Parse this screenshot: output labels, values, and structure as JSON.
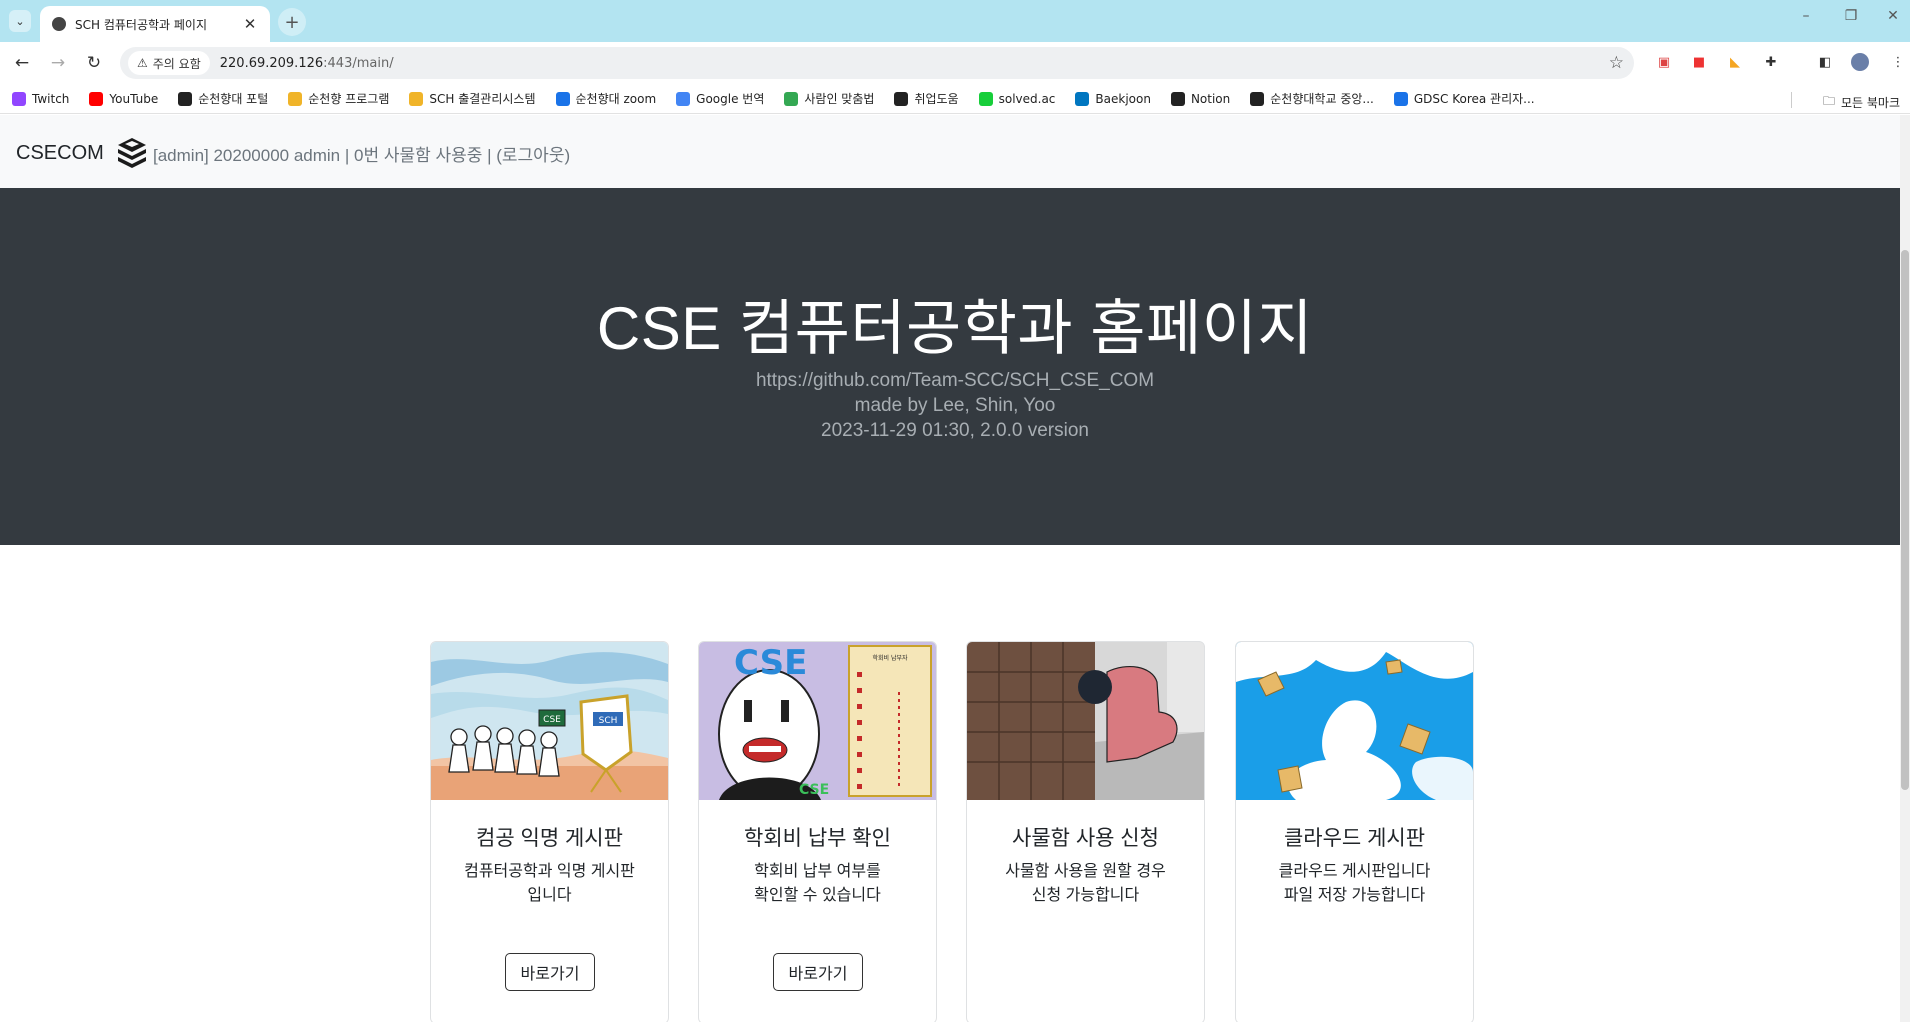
{
  "browser": {
    "tab_title": "SCH 컴퓨터공학과 페이지",
    "security_label": "주의 요함",
    "url_host": "220.69.209.126",
    "url_path": ":443/main/",
    "bookmarks": [
      {
        "label": "Twitch",
        "color": "#9146ff",
        "icon": "twitch-icon"
      },
      {
        "label": "YouTube",
        "color": "#ff0000",
        "icon": "youtube-icon"
      },
      {
        "label": "순천향대 포털",
        "color": "#222222",
        "icon": "globe-icon"
      },
      {
        "label": "순천향 프로그램",
        "color": "#f0b429",
        "icon": "crown-icon"
      },
      {
        "label": "SCH 출결관리시스템",
        "color": "#f0b429",
        "icon": "crown-icon"
      },
      {
        "label": "순천향대 zoom",
        "color": "#1a73e8",
        "icon": "sch-icon"
      },
      {
        "label": "Google 번역",
        "color": "#4285f4",
        "icon": "translate-icon"
      },
      {
        "label": "사람인 맞춤법",
        "color": "#34a853",
        "icon": "dots-icon"
      },
      {
        "label": "취업도움",
        "color": "#222222",
        "icon": "globe-icon"
      },
      {
        "label": "solved.ac",
        "color": "#17ce3a",
        "icon": "solved-icon"
      },
      {
        "label": "Baekjoon",
        "color": "#0076c0",
        "icon": "code-icon"
      },
      {
        "label": "Notion",
        "color": "#222222",
        "icon": "notion-icon"
      },
      {
        "label": "순천향대학교 중앙...",
        "color": "#222222",
        "icon": "globe-icon"
      },
      {
        "label": "GDSC Korea 관리자...",
        "color": "#1a73e8",
        "icon": "gdsc-icon"
      }
    ],
    "all_bookmarks_label": "모든 북마크"
  },
  "site": {
    "brand": "CSECOM",
    "status_text": "[admin] 20200000 admin | 0번 사물함 사용중 | (로그아웃)"
  },
  "hero": {
    "title": "CSE 컴퓨터공학과 홈페이지",
    "repo": "https://github.com/Team-SCC/SCH_CSE_COM",
    "credits": "made by Lee, Shin, Yoo",
    "version": "2023-11-29 01:30, 2.0.0 version"
  },
  "cards": [
    {
      "title": "컴공 익명 게시판",
      "text_lines": [
        "컴퓨터공학과 익명 게시판",
        "입니다"
      ],
      "button": "바로가기"
    },
    {
      "title": "학회비 납부 확인",
      "text_lines": [
        "학회비 납부 여부를",
        "확인할 수 있습니다"
      ],
      "button": "바로가기"
    },
    {
      "title": "사물함 사용 신청",
      "text_lines": [
        "사물함 사용을 원할 경우",
        "신청 가능합니다"
      ],
      "button": ""
    },
    {
      "title": "클라우드 게시판",
      "text_lines": [
        "클라우드 게시판입니다",
        "파일 저장 가능합니다"
      ],
      "button": ""
    }
  ],
  "illustration_text": {
    "card1_sign": "CSE",
    "card1_banner": "SCH",
    "card2_logo": "CSE",
    "card2_list_title": "학회비 납부자",
    "card2_shirt": "CSE"
  },
  "colors": {
    "hero_bg": "#343a40",
    "navbar_bg": "#f8f9fa",
    "tabstrip_bg": "#b3e4f1"
  }
}
